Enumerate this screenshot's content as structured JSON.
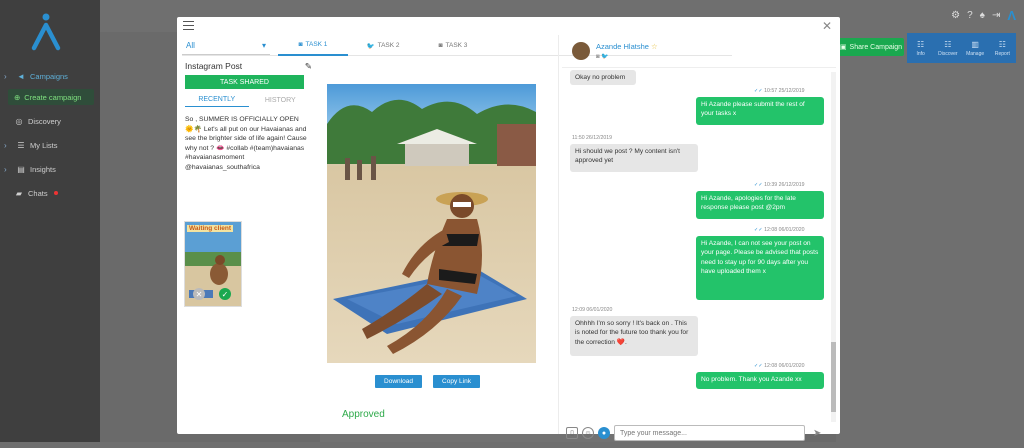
{
  "nav": {
    "items": [
      {
        "label": "Campaigns",
        "icon": "megaphone-icon"
      },
      {
        "label": "Create campaign",
        "icon": "plus-circle-icon"
      },
      {
        "label": "Discovery",
        "icon": "compass-icon"
      },
      {
        "label": "My Lists",
        "icon": "list-icon"
      },
      {
        "label": "Insights",
        "icon": "document-icon"
      },
      {
        "label": "Chats",
        "icon": "chat-icon"
      }
    ]
  },
  "header": {
    "share_label": "Share Campaign",
    "actions": [
      "Info",
      "Discover",
      "Manage",
      "Report"
    ]
  },
  "modal": {
    "filter_value": "All",
    "tabs": [
      "TASK 1",
      "TASK 2",
      "TASK 3"
    ],
    "post_title": "Instagram Post",
    "task_shared": "TASK SHARED",
    "subtabs": [
      "RECENTLY",
      "HISTORY"
    ],
    "caption": "So , SUMMER IS OFFICIALLY OPEN 🌞🌴 Let's all put on our Havaianas and see the brighter side of life again! Cause why not ? 👄 #collab #(team)havaianas #havaianasmoment @havaianas_southafrica",
    "thumb_label": "Waiting client",
    "download_label": "Download",
    "copy_label": "Copy Link",
    "status": "Approved"
  },
  "chat": {
    "name": "Azande Hlatshe",
    "messages": [
      {
        "side": "in",
        "text": "Okay no problem",
        "time": ""
      },
      {
        "side": "out",
        "text": "Hi Azande please submit the rest of your tasks x",
        "time": "10:57 25/12/2019"
      },
      {
        "side": "in",
        "text": "Hi should we post ? My content isn't approved yet",
        "time": "11:50 26/12/2019"
      },
      {
        "side": "out",
        "text": "Hi Azande, apologies for the late response please post @2pm",
        "time": "10:39 26/12/2019"
      },
      {
        "side": "out",
        "text": "Hi Azande, I can not see your post on your page. Please be advised that posts need to stay up for 90 days after you have uploaded them x",
        "time": "12:08 06/01/2020"
      },
      {
        "side": "in",
        "text": "Ohhhh I'm so sorry ! It's back on . This is noted for the future too thank you for the correction ❤️.",
        "time": "12:09 06/01/2020"
      },
      {
        "side": "out",
        "text": "No problem. Thank you Azande xx",
        "time": "12:08 06/01/2020"
      }
    ],
    "input_placeholder": "Type your message..."
  },
  "colors": {
    "brand": "#2a8fd0",
    "success": "#23c36a",
    "sidebar": "#3f3f3f"
  }
}
